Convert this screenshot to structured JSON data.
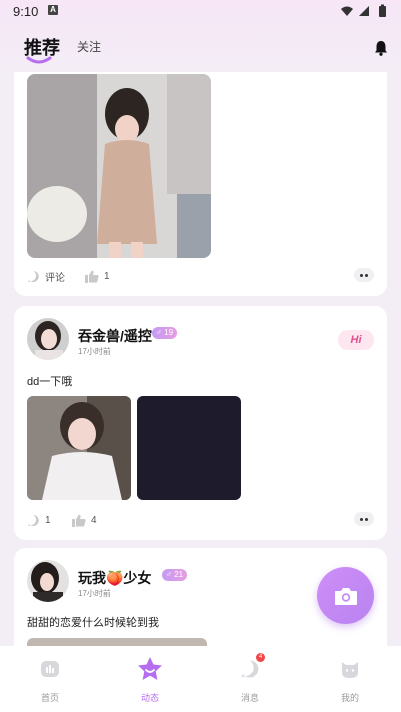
{
  "status_bar": {
    "time": "9:10",
    "notif_letter": "A"
  },
  "header": {
    "tab_active": "推荐",
    "tab_other": "关注"
  },
  "posts": [
    {
      "actions": {
        "comment_label": "评论",
        "like_count": "1"
      }
    },
    {
      "username": "吞金兽/遥控",
      "gender_age": "♂ 19",
      "time": "17小时前",
      "hi_label": "Hi",
      "text": "dd一下哦",
      "actions": {
        "comment_count": "1",
        "like_count": "4"
      }
    },
    {
      "username": "玩我🍑少女",
      "gender_age": "♂ 21",
      "time": "17小时前",
      "text": "甜甜的恋爱什么时候轮到我"
    }
  ],
  "bottom_nav": {
    "items": [
      {
        "label": "首页"
      },
      {
        "label": "动态"
      },
      {
        "label": "消息",
        "badge": "4"
      },
      {
        "label": "我的"
      }
    ]
  },
  "colors": {
    "accent": "#b66ef0",
    "badge": "#f04848",
    "hi_text": "#e0508f"
  }
}
